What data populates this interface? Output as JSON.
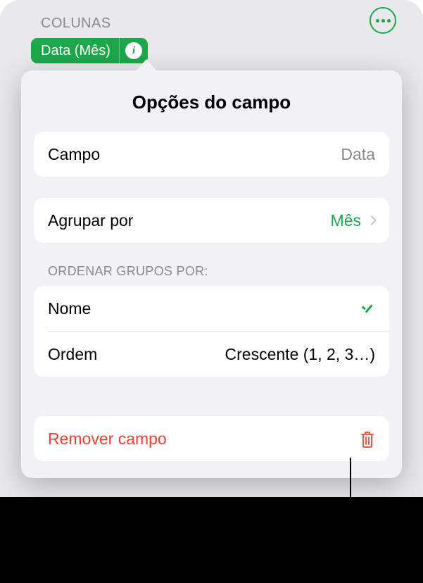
{
  "section_header": "COLUNAS",
  "chip": {
    "label": "Data (Mês)"
  },
  "popover": {
    "title": "Opções do campo",
    "field": {
      "label": "Campo",
      "value": "Data"
    },
    "group_by": {
      "label": "Agrupar por",
      "value": "Mês"
    },
    "sort_caption": "ORDENAR GRUPOS POR:",
    "sort_name": {
      "label": "Nome",
      "selected": true
    },
    "order": {
      "label": "Ordem",
      "value": "Crescente (1, 2, 3…)"
    },
    "remove": {
      "label": "Remover campo"
    }
  },
  "colors": {
    "accent": "#1ba84a",
    "destructive": "#ff3b30"
  }
}
